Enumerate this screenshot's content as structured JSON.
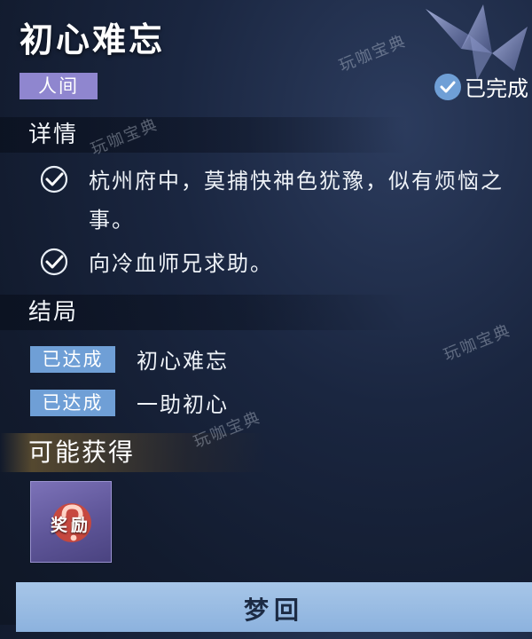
{
  "quest": {
    "title": "初心难忘",
    "realm": "人间",
    "status": "已完成"
  },
  "details": {
    "header": "详情",
    "items": [
      {
        "text": "杭州府中，莫捕快神色犹豫，似有烦恼之事。",
        "done": true
      },
      {
        "text": "向冷血师兄求助。",
        "done": true
      }
    ]
  },
  "endings": {
    "header": "结局",
    "items": [
      {
        "badge": "已达成",
        "name": "初心难忘"
      },
      {
        "badge": "已达成",
        "name": "一助初心"
      }
    ]
  },
  "rewards": {
    "header": "可能获得",
    "items": [
      {
        "label": "奖励",
        "icon": "question-mark-icon"
      }
    ]
  },
  "button": {
    "label": "梦回"
  },
  "watermarks": [
    "玩咖宝典",
    "玩咖宝典",
    "玩咖宝典",
    "玩咖宝典"
  ],
  "colors": {
    "realm_tag": "#8f86cf",
    "badge": "#6f9fd6",
    "button": "#a7c6e8"
  }
}
